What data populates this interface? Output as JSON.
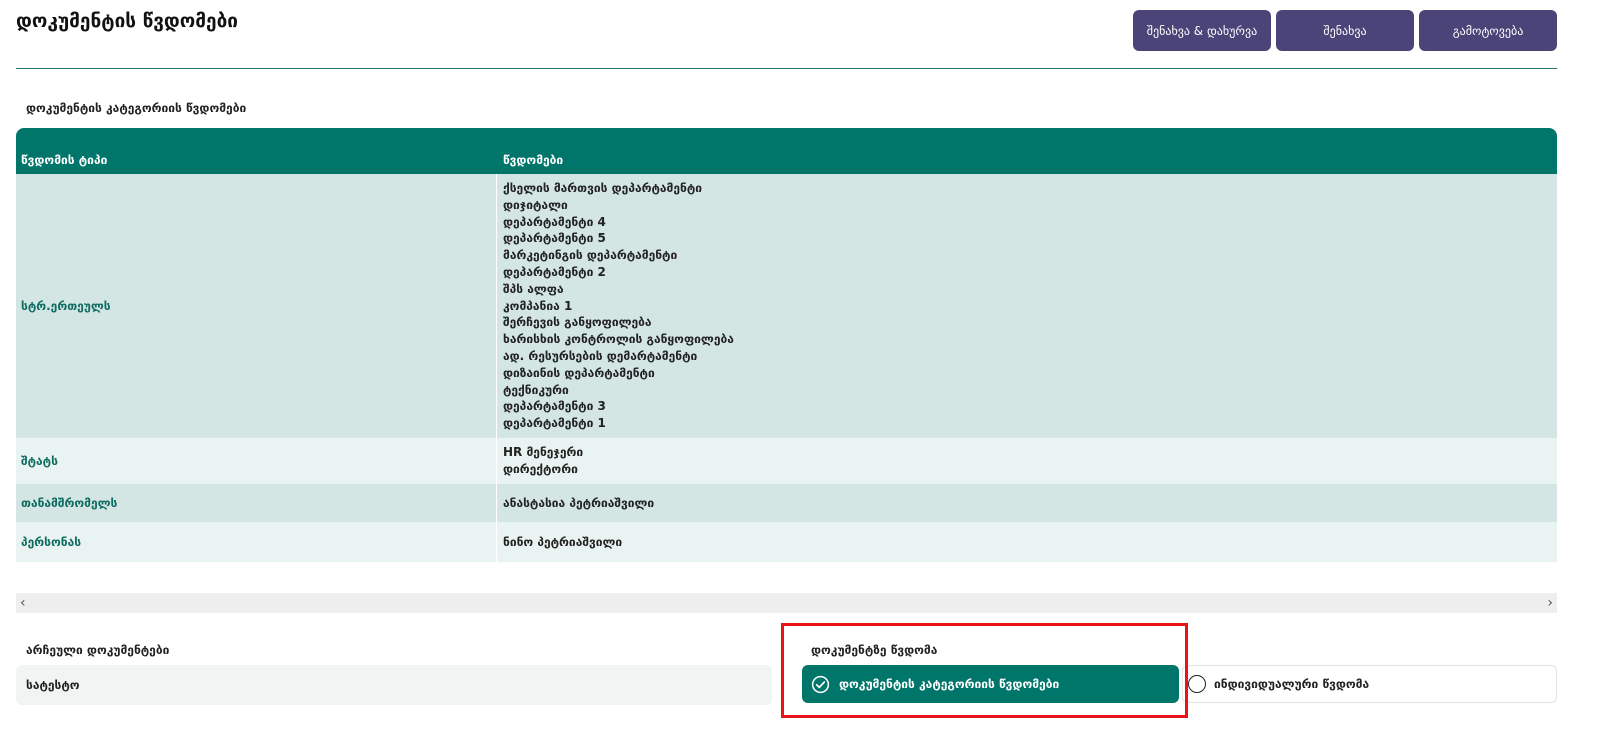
{
  "header": {
    "title": "დოკუმენტის წვდომები",
    "buttons": {
      "save_close": "შენახვა & დახურვა",
      "save": "შენახვა",
      "exit": "გამოტოვება"
    }
  },
  "category_access": {
    "label": "დოკუმენტის კატეგორიის წვდომები",
    "columns": {
      "type": "წვდომის ტიპი",
      "access": "წვდომები"
    },
    "rows": [
      {
        "type": "სტრ.ერთეულს",
        "values": [
          "ქსელის მართვის დეპარტამენტი",
          "დიჯიტალი",
          "დეპარტამენტი 4",
          "დეპარტამენტი 5",
          "მარკეტინგის დეპარტამენტი",
          "დეპარტამენტი 2",
          "შპს ალფა",
          "კომპანია 1",
          "შერჩევის განყოფილება",
          "ხარისხის კონტროლის განყოფილება",
          "ად. რესურსების დემარტამენტი",
          "დიზაინის დეპარტამენტი",
          "ტექნიკური",
          "დეპარტამენტი 3",
          "დეპარტამენტი 1"
        ]
      },
      {
        "type": "შტატს",
        "values": [
          "HR მენეჯერი",
          "დირექტორი"
        ]
      },
      {
        "type": "თანამშრომელს",
        "values": [
          "ანასტასია პეტრიაშვილი"
        ]
      },
      {
        "type": "პერსონას",
        "values": [
          "ნინო პეტრიაშვილი"
        ]
      }
    ]
  },
  "chosen_documents": {
    "label": "არჩეული დოკუმენტები",
    "value": "სატესტო"
  },
  "document_access": {
    "label": "დოკუმენტზე წვდომა",
    "options": {
      "selected": "დოკუმენტის კატეგორიის წვდომები",
      "other": "ინდივიდუალური წვდომა"
    }
  },
  "scroll": {
    "left": "‹",
    "right": "›"
  }
}
